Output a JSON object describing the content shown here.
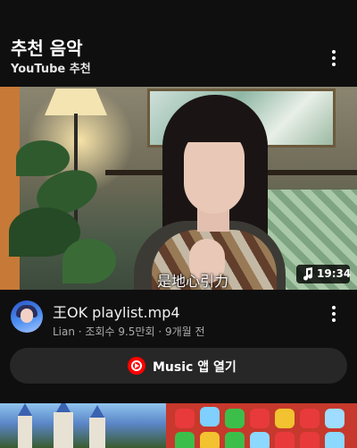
{
  "header": {
    "title": "추천 음악",
    "subtitle": "YouTube 추천"
  },
  "video": {
    "subtitle_overlay": "是地心引力",
    "duration": "19:34",
    "title": "王OK playlist.mp4",
    "meta": "Lian · 조회수 9.5만회 · 9개월 전"
  },
  "music_button": {
    "label": "Music 앱 열기"
  },
  "colors": {
    "background": "#0f0f0f",
    "button_bg": "#272727",
    "youtube_red": "#ff0000",
    "meta_text": "#aaaaaa"
  },
  "icons": [
    "more-vert-icon",
    "music-note-icon",
    "youtube-music-icon",
    "channel-avatar"
  ]
}
